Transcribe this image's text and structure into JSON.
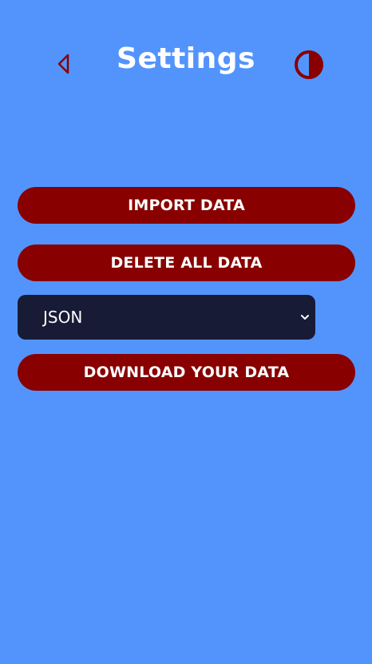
{
  "header": {
    "title": "Settings",
    "back_icon": "back-triangle-icon",
    "theme_icon": "contrast-half-circle-icon"
  },
  "actions": {
    "import_label": "IMPORT DATA",
    "delete_label": "DELETE ALL DATA",
    "download_label": "DOWNLOAD YOUR DATA"
  },
  "format_select": {
    "selected": "JSON"
  },
  "colors": {
    "background": "#5394fc",
    "button": "#880000",
    "select_bg": "#181b36",
    "text": "#ffffff"
  }
}
